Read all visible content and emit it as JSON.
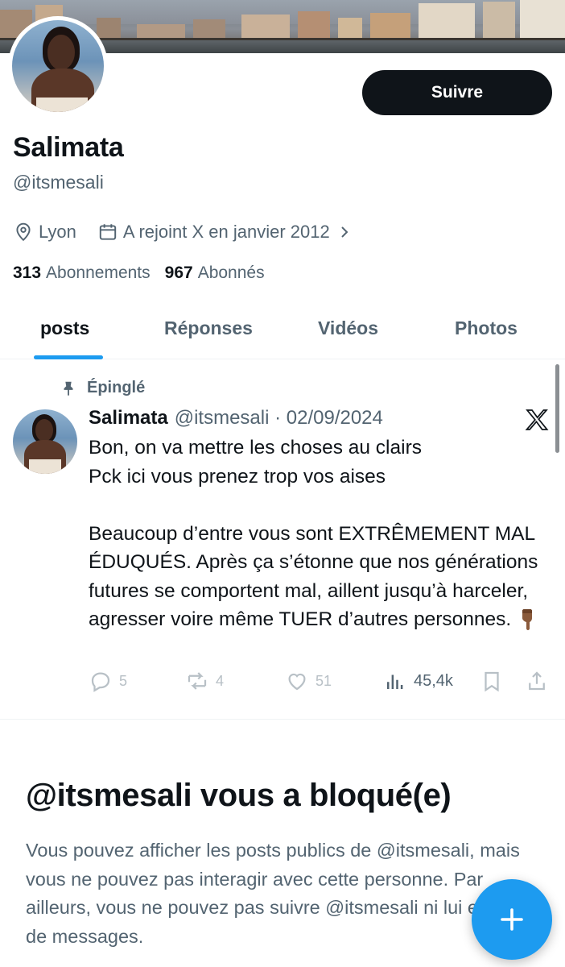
{
  "profile": {
    "follow_label": "Suivre",
    "display_name": "Salimata",
    "handle": "@itsmesali",
    "location": "Lyon",
    "joined": "A rejoint X en janvier 2012",
    "following_count": "313",
    "following_label": "Abonnements",
    "followers_count": "967",
    "followers_label": "Abonnés"
  },
  "tabs": [
    {
      "label": "posts"
    },
    {
      "label": "Réponses"
    },
    {
      "label": "Vidéos"
    },
    {
      "label": "Photos"
    }
  ],
  "post": {
    "pinned_label": "Épinglé",
    "author_name": "Salimata",
    "author_handle_date": "@itsmesali · 02/09/2024",
    "text_paragraph_1": "Bon, on va mettre les choses au clairs\nPck ici vous prenez trop vos aises",
    "text_paragraph_2": "Beaucoup d’entre vous sont EXTRÊMEMENT MAL ÉDUQUÉS. Après ça s’étonne que nos générations futures se comportent mal, aillent jusqu’à harceler, agresser voire même TUER d’autres personnes.",
    "emoji": "pointing-down-emoji",
    "replies": "5",
    "reposts": "4",
    "likes": "51",
    "views": "45,4k"
  },
  "blocked": {
    "title": "@itsmesali vous a bloqué(e)",
    "message": "Vous pouvez afficher les posts publics de @itsmesali, mais vous ne pouvez pas interagir avec cette personne. Par ailleurs, vous ne pouvez pas suivre @itsmesali ni lui envoyer de messages."
  },
  "colors": {
    "accent": "#1d9bf0",
    "text_primary": "#0f1419",
    "text_secondary": "#536471"
  },
  "icons": [
    "location-pin-icon",
    "calendar-icon",
    "chevron-right-icon",
    "pin-icon",
    "x-logo-icon",
    "reply-icon",
    "repost-icon",
    "like-icon",
    "views-icon",
    "bookmark-icon",
    "share-icon",
    "compose-plus-icon"
  ]
}
